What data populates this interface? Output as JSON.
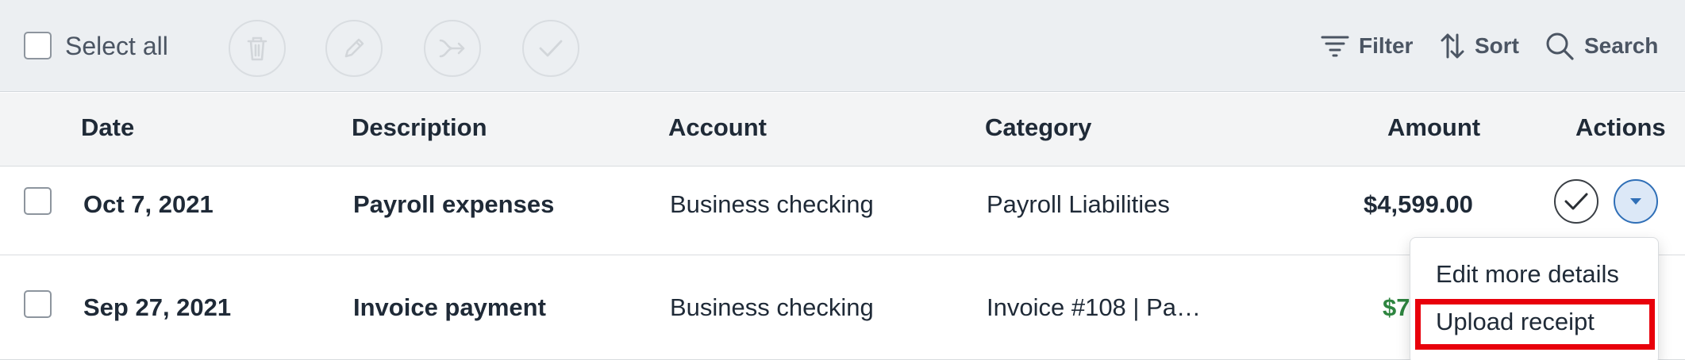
{
  "toolbar": {
    "select_all_label": "Select all",
    "filter_label": "Filter",
    "sort_label": "Sort",
    "search_label": "Search"
  },
  "table": {
    "columns": [
      "Date",
      "Description",
      "Account",
      "Category",
      "Amount",
      "Actions"
    ],
    "rows": [
      {
        "date": "Oct 7, 2021",
        "description": "Payroll expenses",
        "account": "Business checking",
        "category": "Payroll Liabilities",
        "amount": "$4,599.00"
      },
      {
        "date": "Sep 27, 2021",
        "description": "Invoice payment",
        "account": "Business checking",
        "category": "Invoice #108 | Pa…",
        "amount_partial": "$7"
      }
    ]
  },
  "actions_menu": {
    "items": [
      "Edit more details",
      "Upload receipt"
    ]
  },
  "colors": {
    "toolbar_bg": "#eceff2",
    "header_bg": "#f3f4f5",
    "accent_blue": "#2f6fb7",
    "income_green": "#2e8540",
    "highlight_red": "#e8000b"
  }
}
